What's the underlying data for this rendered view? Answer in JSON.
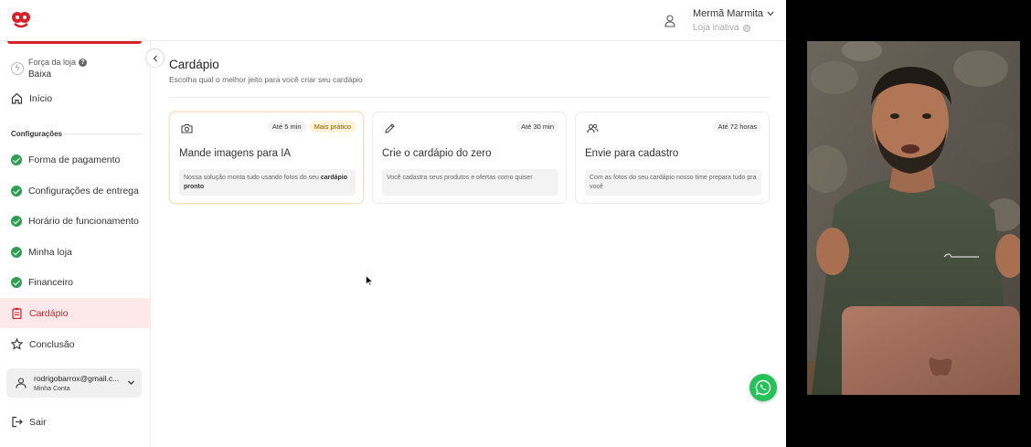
{
  "header": {
    "user_name": "Mermã Marmita",
    "store_status": "Loja inativa"
  },
  "sidebar": {
    "store_strength_label": "Força da loja",
    "store_strength_value": "Baixa",
    "home_label": "Início",
    "section_label": "Configurações",
    "items": [
      {
        "label": "Forma de pagamento",
        "icon": "check-icon",
        "done": true
      },
      {
        "label": "Configurações de entrega",
        "icon": "check-icon",
        "done": true
      },
      {
        "label": "Horário de funcionamento",
        "icon": "check-icon",
        "done": true
      },
      {
        "label": "Minha loja",
        "icon": "check-icon",
        "done": true
      },
      {
        "label": "Financeiro",
        "icon": "check-icon",
        "done": true
      },
      {
        "label": "Cardápio",
        "icon": "clipboard-icon",
        "active": true
      },
      {
        "label": "Conclusão",
        "icon": "star-icon"
      }
    ],
    "account": {
      "email": "rodrigobarrox@gmail.c...",
      "subtitle": "Minha Conta"
    },
    "logout_label": "Sair"
  },
  "main": {
    "title": "Cardápio",
    "subtitle": "Escolha qual o melhor jeito para você criar seu cardápio",
    "cards": [
      {
        "icon": "camera-icon",
        "badges": [
          "Até 5 min",
          "Mais prático"
        ],
        "title": "Mande imagens para IA",
        "description_prefix": "Nossa solução monta tudo usando fotos do seu",
        "description_bold": "cardápio pronto"
      },
      {
        "icon": "pencil-icon",
        "badges": [
          "Até 30 min"
        ],
        "title": "Crie o cardápio do zero",
        "description_prefix": "Você cadastra seus produtos e ofertas como quiser",
        "description_bold": ""
      },
      {
        "icon": "users-icon",
        "badges": [
          "Até 72 horas"
        ],
        "title": "Envie para cadastro",
        "description_prefix": "Com as fotos do seu cardápio nosso time prepara tudo pra você",
        "description_bold": ""
      }
    ]
  },
  "colors": {
    "brand_red": "#d8202b",
    "success_green": "#2e9e55",
    "active_bg": "#fde8ea",
    "whatsapp_green": "#25c25a"
  }
}
